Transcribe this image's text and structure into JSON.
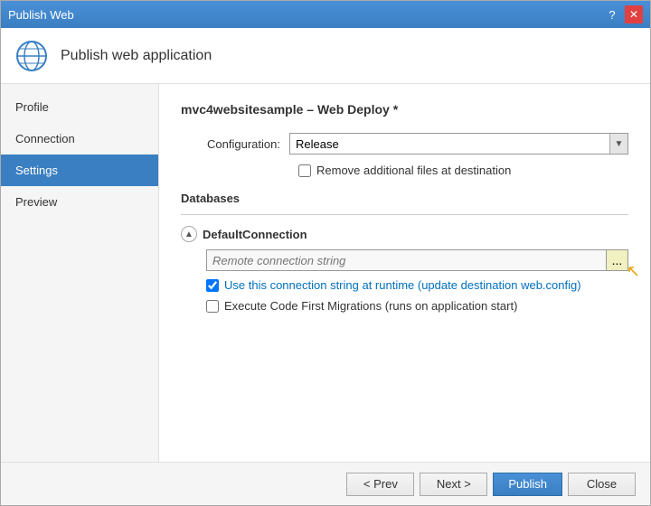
{
  "window": {
    "title": "Publish Web",
    "help_label": "?",
    "close_label": "✕"
  },
  "header": {
    "icon_alt": "globe-icon",
    "title": "Publish web application"
  },
  "sidebar": {
    "items": [
      {
        "id": "profile",
        "label": "Profile",
        "active": false
      },
      {
        "id": "connection",
        "label": "Connection",
        "active": false
      },
      {
        "id": "settings",
        "label": "Settings",
        "active": true
      },
      {
        "id": "preview",
        "label": "Preview",
        "active": false
      }
    ]
  },
  "main": {
    "page_title": "mvc4websitesample – Web Deploy *",
    "configuration_label": "Configuration:",
    "configuration_value": "Release",
    "remove_files_label": "Remove additional files at destination",
    "databases_section_title": "Databases",
    "db_item": {
      "name": "DefaultConnection",
      "connection_string_placeholder": "Remote connection string",
      "use_connection_string_label": "Use this connection string at runtime (update destination web.config)",
      "execute_migrations_label": "Execute Code First Migrations (runs on application start)"
    }
  },
  "footer": {
    "prev_label": "< Prev",
    "next_label": "Next >",
    "publish_label": "Publish",
    "close_label": "Close"
  }
}
